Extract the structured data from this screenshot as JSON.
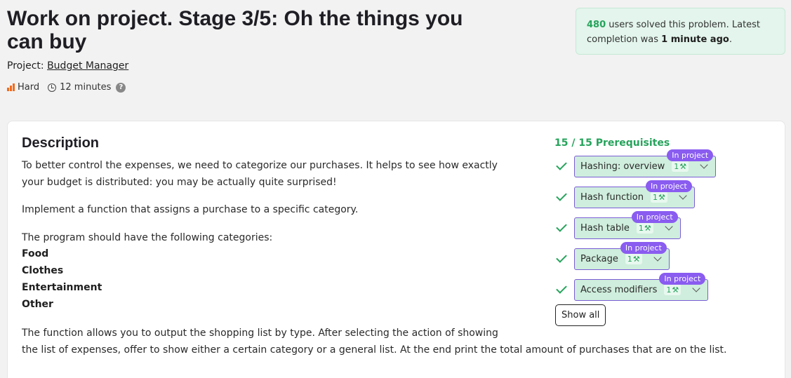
{
  "header": {
    "title": "Work on project. Stage 3/5: Oh the things you can buy",
    "project_label": "Project:",
    "project_name": "Budget Manager",
    "difficulty": "Hard",
    "duration": "12 minutes",
    "help": "?"
  },
  "solved_box": {
    "count": "480",
    "text_mid": " users solved this problem. Latest completion was ",
    "latest": "1 minute ago",
    "end": "."
  },
  "description": {
    "heading": "Description",
    "p1_line1": "To better control the expenses, we need to categorize our purchases. It helps to see how exactly",
    "p1_line2": "your budget is distributed: you may be actually quite surprised!",
    "p2": "Implement a function that assigns a purchase to a specific category.",
    "p3": "The program should have the following categories:",
    "categories": [
      "Food",
      "Clothes",
      "Entertainment",
      "Other"
    ],
    "p4_line1": "The function allows you to output the shopping list by type. After selecting the action of showing",
    "p4_line2": "the list of expenses, offer to show either a certain category or a general list. At the end print the total amount of purchases that are on the list."
  },
  "prerequisites": {
    "title": "15 / 15 Prerequisites",
    "badge_label": "In project",
    "items": [
      {
        "name": "Hashing: overview",
        "count": "1"
      },
      {
        "name": "Hash function",
        "count": "1"
      },
      {
        "name": "Hash table",
        "count": "1"
      },
      {
        "name": "Package",
        "count": "1"
      },
      {
        "name": "Access modifiers",
        "count": "1"
      }
    ],
    "show_all": "Show all"
  },
  "colors": {
    "accent_green": "#26a35b",
    "badge_purple": "#8a5cf0",
    "difficulty_orange": "#f26b1d"
  }
}
